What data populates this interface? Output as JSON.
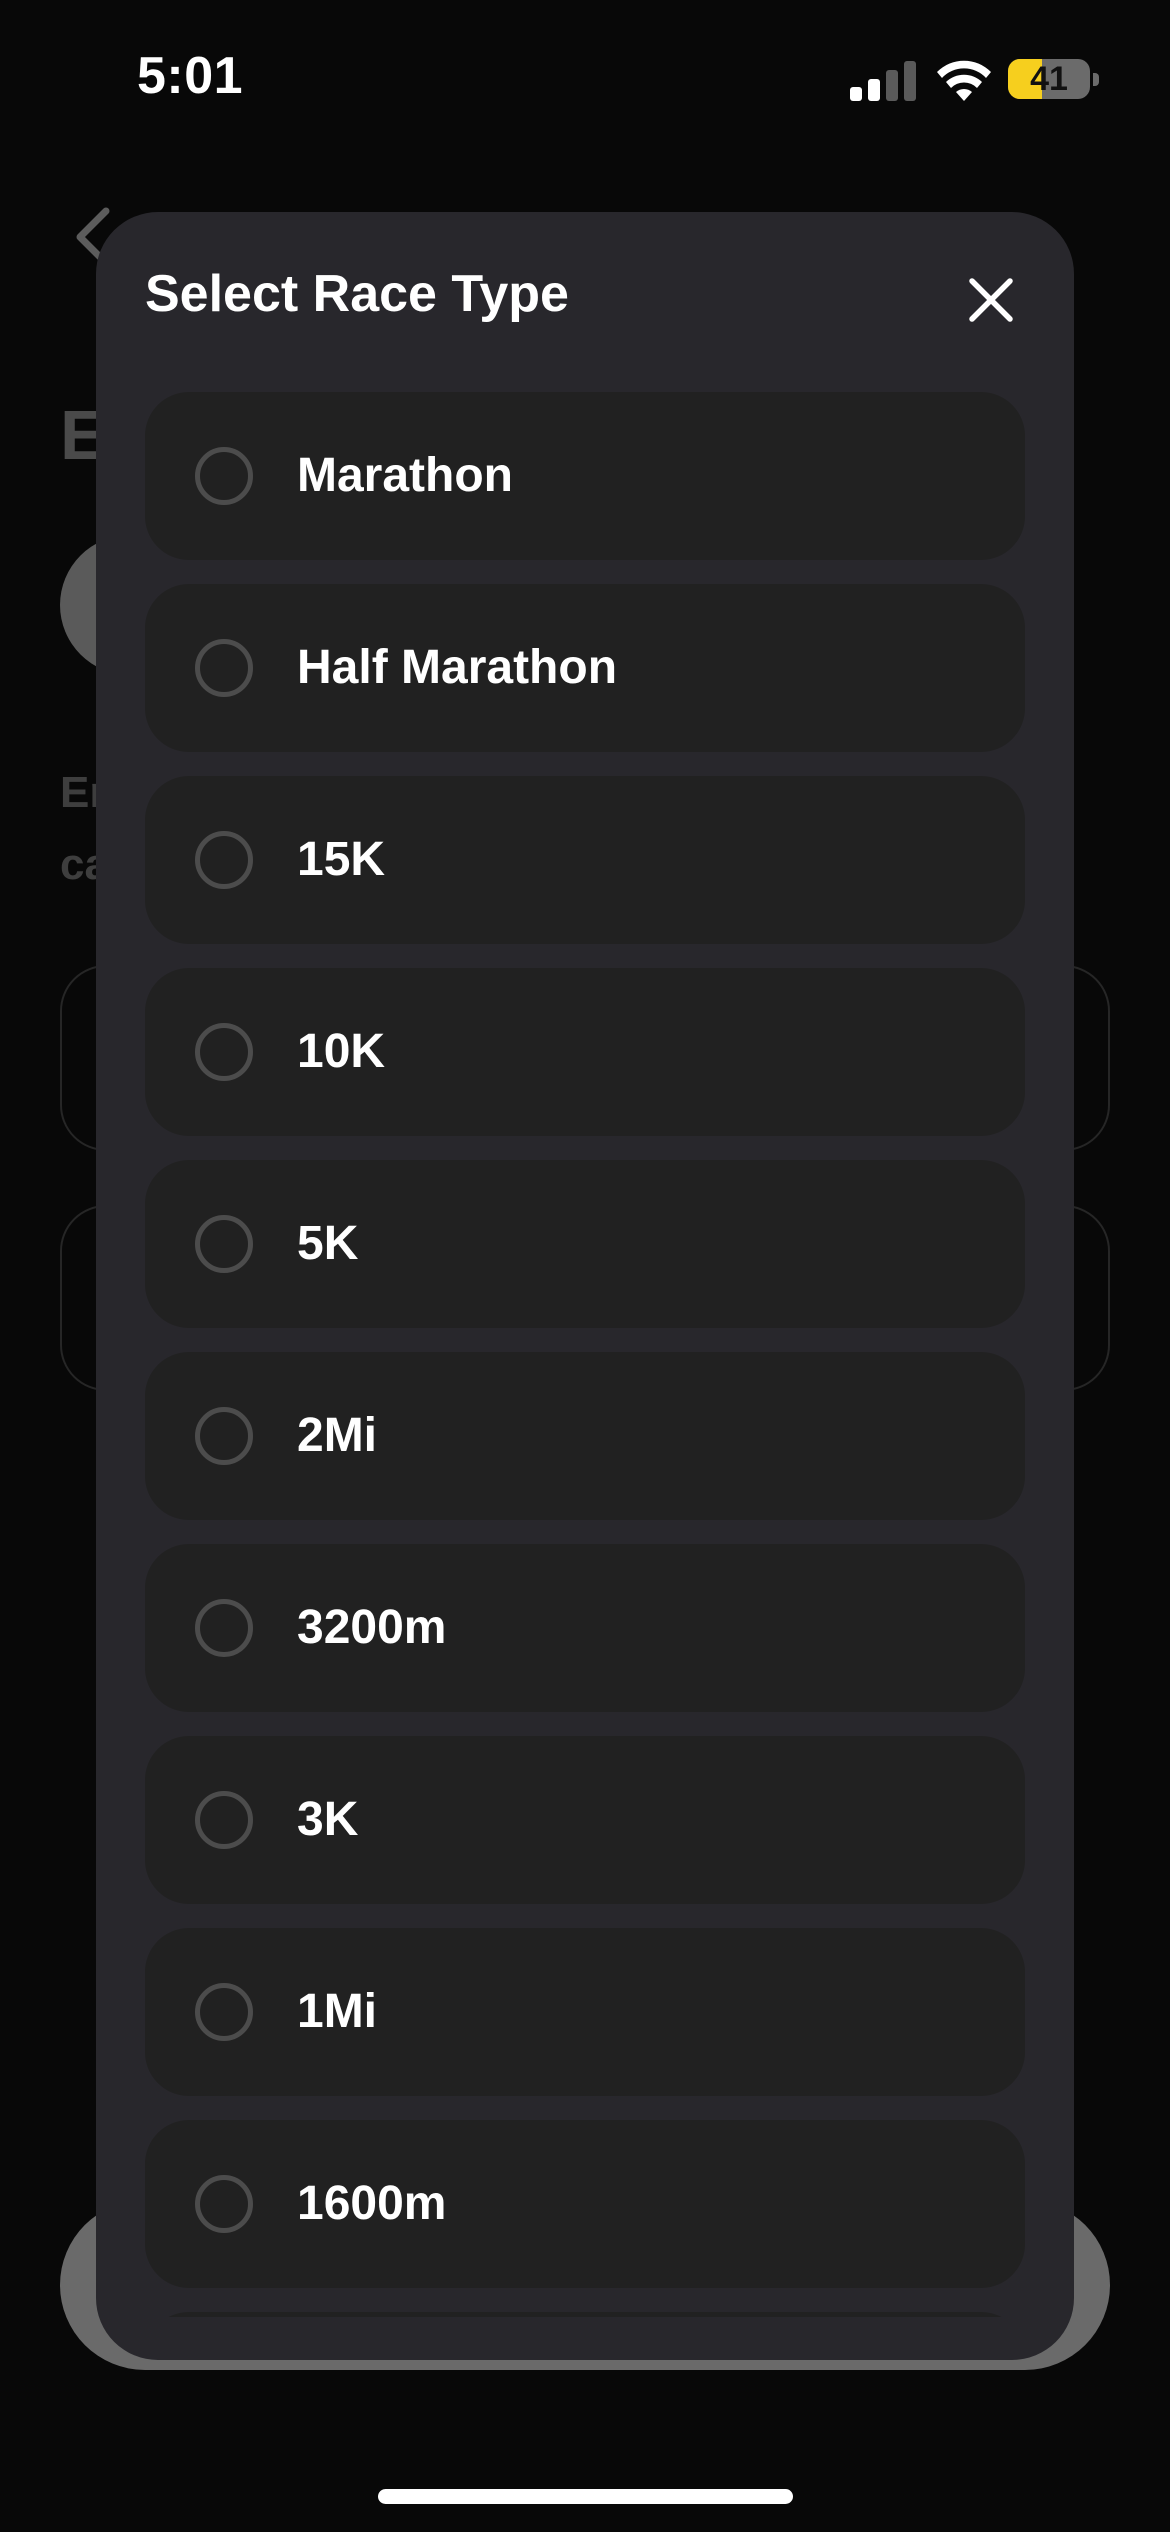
{
  "status_bar": {
    "time": "5:01",
    "battery_level": "41",
    "battery_fraction": 0.41,
    "signal_bars_active": 2,
    "accent_battery_color": "#f6cf1e"
  },
  "background_page": {
    "back_icon": "chevron-left-icon",
    "title_fragment": "E",
    "description_fragment": "Er\nca"
  },
  "sheet": {
    "title": "Select Race Type",
    "close_icon": "close-icon",
    "options": [
      {
        "label": "Marathon",
        "selected": false
      },
      {
        "label": "Half Marathon",
        "selected": false
      },
      {
        "label": "15K",
        "selected": false
      },
      {
        "label": "10K",
        "selected": false
      },
      {
        "label": "5K",
        "selected": false
      },
      {
        "label": "2Mi",
        "selected": false
      },
      {
        "label": "3200m",
        "selected": false
      },
      {
        "label": "3K",
        "selected": false
      },
      {
        "label": "1Mi",
        "selected": false
      },
      {
        "label": "1600m",
        "selected": false
      },
      {
        "label": "",
        "selected": false
      }
    ]
  },
  "colors": {
    "background": "#080808",
    "sheet": "#28272c",
    "option": "#212121",
    "radio_border": "#4c4c4c",
    "text": "#ffffff"
  }
}
